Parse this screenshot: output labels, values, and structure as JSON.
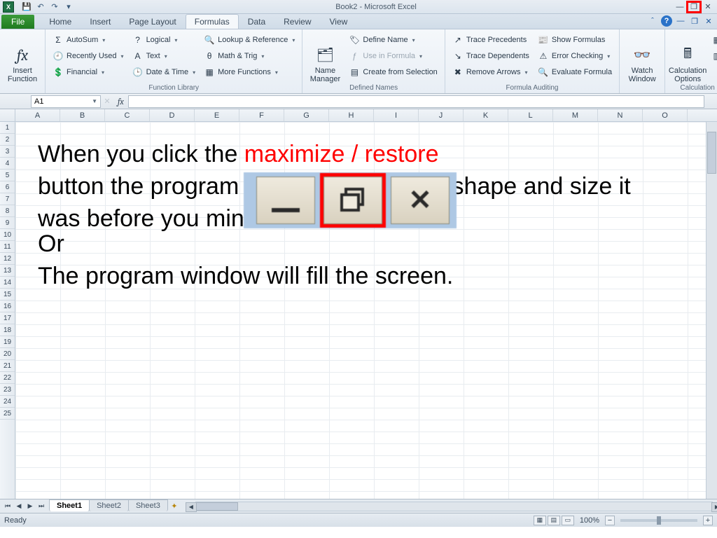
{
  "app_title": "Book2 - Microsoft Excel",
  "qat": {
    "save": "💾",
    "undo": "↶",
    "redo": "↷"
  },
  "window_controls": {
    "minimize": "—",
    "restore": "❐",
    "close": "✕"
  },
  "file_tab": "File",
  "tabs": [
    "Home",
    "Insert",
    "Page Layout",
    "Formulas",
    "Data",
    "Review",
    "View"
  ],
  "active_tab": "Formulas",
  "ribbon": {
    "insert_function": {
      "label": "Insert\nFunction",
      "fx": "fx"
    },
    "function_library": {
      "label": "Function Library",
      "items": [
        "AutoSum",
        "Recently Used",
        "Financial",
        "Logical",
        "Text",
        "Date & Time",
        "Lookup & Reference",
        "Math & Trig",
        "More Functions"
      ]
    },
    "defined_names": {
      "label": "Defined Names",
      "name_manager": "Name\nManager",
      "items": [
        "Define Name",
        "Use in Formula",
        "Create from Selection"
      ]
    },
    "formula_auditing": {
      "label": "Formula Auditing",
      "left": [
        "Trace Precedents",
        "Trace Dependents",
        "Remove Arrows"
      ],
      "right": [
        "Show Formulas",
        "Error Checking",
        "Evaluate Formula"
      ]
    },
    "watch_window": "Watch\nWindow",
    "calculation": {
      "label": "Calculation",
      "options": "Calculation\nOptions"
    }
  },
  "name_box": "A1",
  "fx": "fx",
  "columns": [
    "A",
    "B",
    "C",
    "D",
    "E",
    "F",
    "G",
    "H",
    "I",
    "J",
    "K",
    "L",
    "M",
    "N",
    "O"
  ],
  "rows": [
    "1",
    "2",
    "3",
    "4",
    "5",
    "6",
    "7",
    "8",
    "9",
    "10",
    "11",
    "12",
    "13",
    "14",
    "15",
    "16",
    "17",
    "18",
    "19",
    "20",
    "21",
    "22",
    "23",
    "24",
    "25"
  ],
  "overlay": {
    "line1a": "When you click the ",
    "line1b": "maximize / restore",
    "line2": "button the program assumes the same shape and size it was before you minimized it.",
    "line3": "Or",
    "line4": "The program window will fill the screen."
  },
  "sheet_tabs": [
    "Sheet1",
    "Sheet2",
    "Sheet3"
  ],
  "status": {
    "ready": "Ready",
    "zoom": "100%"
  }
}
